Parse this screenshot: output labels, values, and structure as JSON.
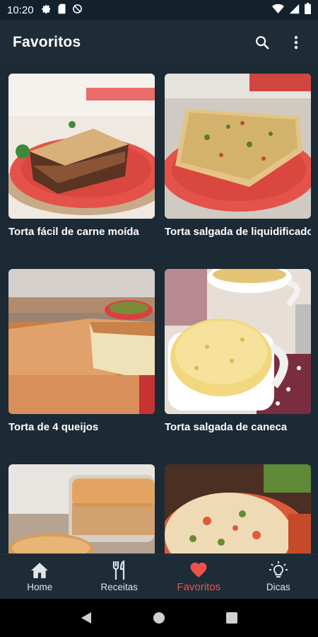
{
  "status_bar": {
    "time": "10:20",
    "left_icons": [
      "gear-icon",
      "sim-card-icon",
      "no-data-icon"
    ],
    "right_icons": [
      "wifi-icon",
      "signal-icon",
      "battery-icon"
    ]
  },
  "app_bar": {
    "title": "Favoritos",
    "actions": [
      "search-icon",
      "more-vert-icon"
    ]
  },
  "recipes": [
    {
      "title": "Torta fácil de carne moída"
    },
    {
      "title": "Torta salgada de liquidificador"
    },
    {
      "title": "Torta de 4 queijos"
    },
    {
      "title": "Torta salgada de caneca"
    },
    {
      "title": ""
    },
    {
      "title": ""
    }
  ],
  "bottom_nav": {
    "items": [
      {
        "label": "Home",
        "icon": "home-icon"
      },
      {
        "label": "Receitas",
        "icon": "utensils-icon"
      },
      {
        "label": "Favoritos",
        "icon": "heart-icon"
      },
      {
        "label": "Dicas",
        "icon": "lightbulb-icon"
      }
    ],
    "active": "Favoritos"
  },
  "colors": {
    "background": "#1c2a35",
    "app_bar": "#1e2c37",
    "accent": "#f0524b"
  }
}
